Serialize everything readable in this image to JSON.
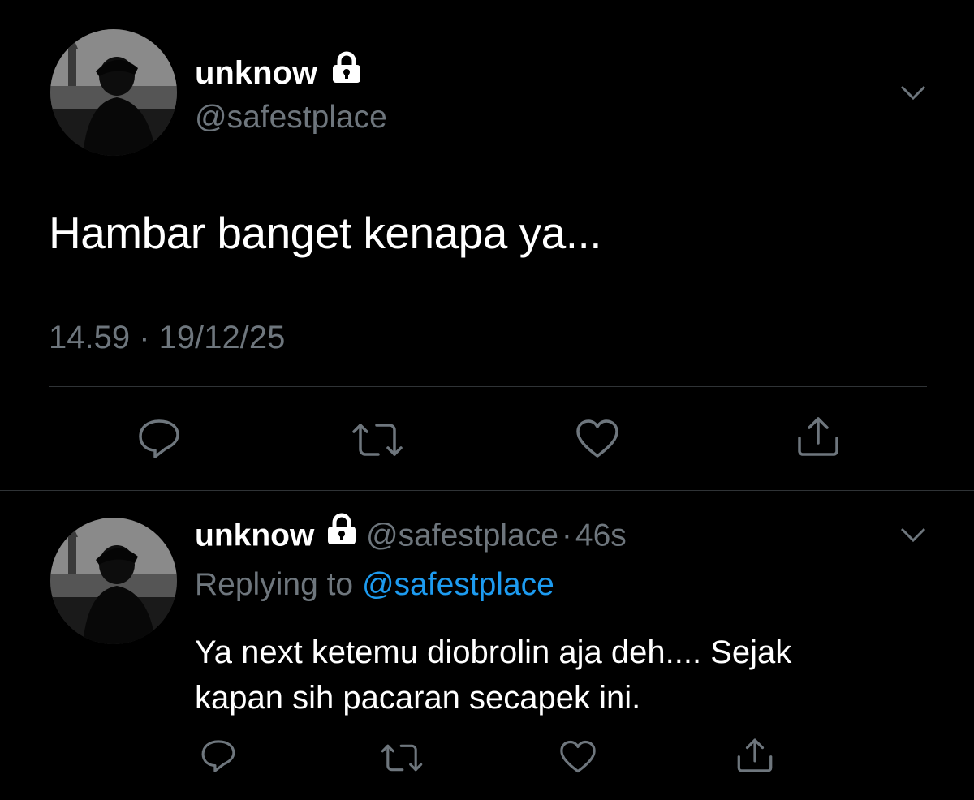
{
  "main_tweet": {
    "display_name": "unknow",
    "handle": "@safestplace",
    "text": "Hambar banget kenapa ya...",
    "timestamp": "14.59 · 19/12/25",
    "avatar_icon": "avatar-photo",
    "lock_icon": "lock-icon",
    "menu_icon": "chevron-down-icon"
  },
  "reply_tweet": {
    "display_name": "unknow",
    "handle": "@safestplace",
    "separator": "·",
    "time_ago": "46s",
    "replying_prefix": "Replying to",
    "replying_handle": "@safestplace",
    "text_line1": "Ya next ketemu diobrolin aja deh.... Sejak",
    "text_line2": "kapan sih pacaran secapek ini."
  },
  "actions": [
    "reply-icon",
    "retweet-icon",
    "like-icon",
    "share-icon"
  ],
  "colors": {
    "background": "#000000",
    "text": "#ffffff",
    "muted": "#6e767d",
    "link": "#1d9bf0",
    "divider": "#2f3336"
  }
}
